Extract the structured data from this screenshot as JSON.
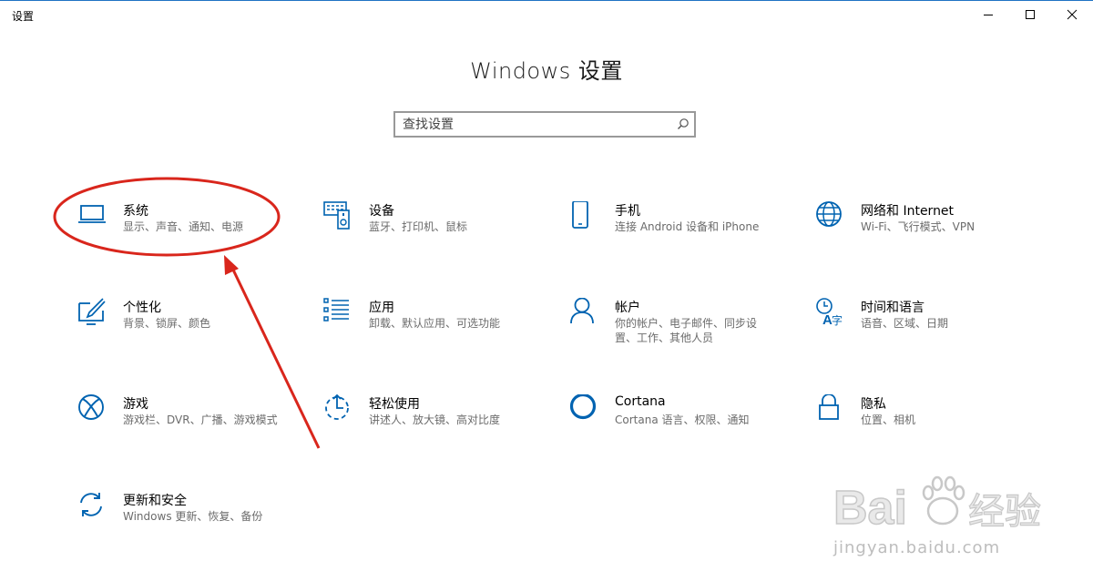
{
  "window": {
    "app_title": "设置"
  },
  "page": {
    "title": "Windows 设置"
  },
  "search": {
    "placeholder": "查找设置",
    "value": ""
  },
  "accent_color": "#0063b1",
  "annotation_color": "#d9261c",
  "categories": [
    {
      "name": "系统",
      "desc": "显示、声音、通知、电源",
      "icon": "laptop-icon"
    },
    {
      "name": "设备",
      "desc": "蓝牙、打印机、鼠标",
      "icon": "devices-icon"
    },
    {
      "name": "手机",
      "desc": "连接 Android 设备和 iPhone",
      "icon": "phone-icon"
    },
    {
      "name": "网络和 Internet",
      "desc": "Wi-Fi、飞行模式、VPN",
      "icon": "globe-icon"
    },
    {
      "name": "个性化",
      "desc": "背景、锁屏、颜色",
      "icon": "personalization-icon"
    },
    {
      "name": "应用",
      "desc": "卸载、默认应用、可选功能",
      "icon": "apps-list-icon"
    },
    {
      "name": "帐户",
      "desc": "你的帐户、电子邮件、同步设置、工作、其他人员",
      "icon": "person-icon"
    },
    {
      "name": "时间和语言",
      "desc": "语音、区域、日期",
      "icon": "time-language-icon"
    },
    {
      "name": "游戏",
      "desc": "游戏栏、DVR、广播、游戏模式",
      "icon": "xbox-icon"
    },
    {
      "name": "轻松使用",
      "desc": "讲述人、放大镜、高对比度",
      "icon": "ease-of-access-icon"
    },
    {
      "name": "Cortana",
      "desc": "Cortana 语言、权限、通知",
      "icon": "cortana-icon"
    },
    {
      "name": "隐私",
      "desc": "位置、相机",
      "icon": "lock-icon"
    },
    {
      "name": "更新和安全",
      "desc": "Windows 更新、恢复、备份",
      "icon": "sync-icon"
    }
  ],
  "watermark": {
    "brand": "Bai 经验",
    "url": "jingyan.baidu.com"
  }
}
